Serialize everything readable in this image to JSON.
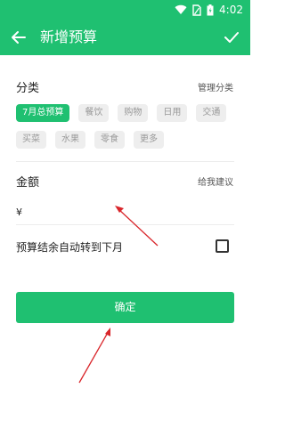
{
  "status_bar": {
    "time": "4:02",
    "icons": [
      "wifi-icon",
      "sim-icon",
      "battery-icon"
    ]
  },
  "app_bar": {
    "title": "新增预算",
    "back_icon": "back-arrow-icon",
    "confirm_icon": "check-icon"
  },
  "category": {
    "label": "分类",
    "manage_link": "管理分类",
    "chips": [
      {
        "label": "7月总预算",
        "active": true
      },
      {
        "label": "餐饮",
        "active": false
      },
      {
        "label": "购物",
        "active": false
      },
      {
        "label": "日用",
        "active": false
      },
      {
        "label": "交通",
        "active": false
      },
      {
        "label": "买菜",
        "active": false
      },
      {
        "label": "水果",
        "active": false
      },
      {
        "label": "零食",
        "active": false
      },
      {
        "label": "更多",
        "active": false
      }
    ]
  },
  "amount": {
    "label": "金额",
    "suggest_link": "给我建议",
    "currency": "¥",
    "value": ""
  },
  "rollover": {
    "label": "预算结余自动转到下月",
    "checked": false
  },
  "submit": {
    "label": "确定"
  },
  "colors": {
    "accent": "#1fc071",
    "annotation": "#d9262b"
  }
}
